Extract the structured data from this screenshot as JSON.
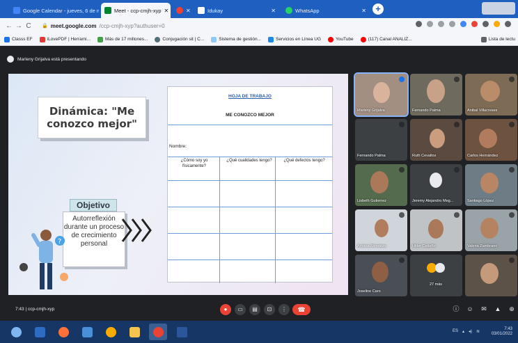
{
  "browser": {
    "tabs": [
      {
        "label": "Google Calendar - jueves, 6 de m",
        "active": false
      },
      {
        "label": "Meet - ccp-cmjh-xyp",
        "active": true
      },
      {
        "label": "",
        "active": false
      },
      {
        "label": "Idukay",
        "active": false
      },
      {
        "label": "WhatsApp",
        "active": false
      }
    ],
    "url_host": "meet.google.com",
    "url_path": "/ccp-cmjh-xyp?authuser=0",
    "bookmarks": [
      "Classs EF",
      "iLovePDF | Herrami...",
      "Más de 17 millones...",
      "Conjugación sit | C...",
      "Sistema de gestión...",
      "Servicios en Línea UG",
      "YouTube",
      "(117) Canal ANALIZ...",
      "Lista de lectu"
    ]
  },
  "meet": {
    "presenting_text": "Marleny Grijalva está presentando",
    "meeting_code": "7:43 | ccp-cmjh-xyp"
  },
  "slide": {
    "title": "Dinámica: \"Me conozco mejor\"",
    "objective_label": "Objetivo",
    "objective_text": "Autorreflexión durante un proceso de crecimiento personal",
    "worksheet_title": "HOJA DE TRABAJO",
    "worksheet_subtitle": "ME CONOZCO MEJOR",
    "name_label": "Nombre:",
    "columns": [
      "¿Cómo soy yo físicamente?",
      "¿Qué cualidades tengo?",
      "¿Qué defectos tengo?"
    ]
  },
  "participants": [
    {
      "name": "Marleny Grijalva"
    },
    {
      "name": "Fernando Palma"
    },
    {
      "name": "Anibal Villacreses"
    },
    {
      "name": "Fernando Palma"
    },
    {
      "name": "Ruth Cevallos"
    },
    {
      "name": "Carlos Hernández"
    },
    {
      "name": "Lisbeth Gutierrez"
    },
    {
      "name": "Jeremy Alejandro Meg..."
    },
    {
      "name": "Santiago López"
    },
    {
      "name": "Andrea Mendoza"
    },
    {
      "name": "Hitler Cedeño"
    },
    {
      "name": "Valeria Zambrano"
    },
    {
      "name": "Joseline Caro"
    },
    {
      "name": "27 más"
    },
    {
      "name": ""
    }
  ],
  "taskbar": {
    "lang": "ES",
    "time": "7:43",
    "date": "03/01/2022"
  }
}
